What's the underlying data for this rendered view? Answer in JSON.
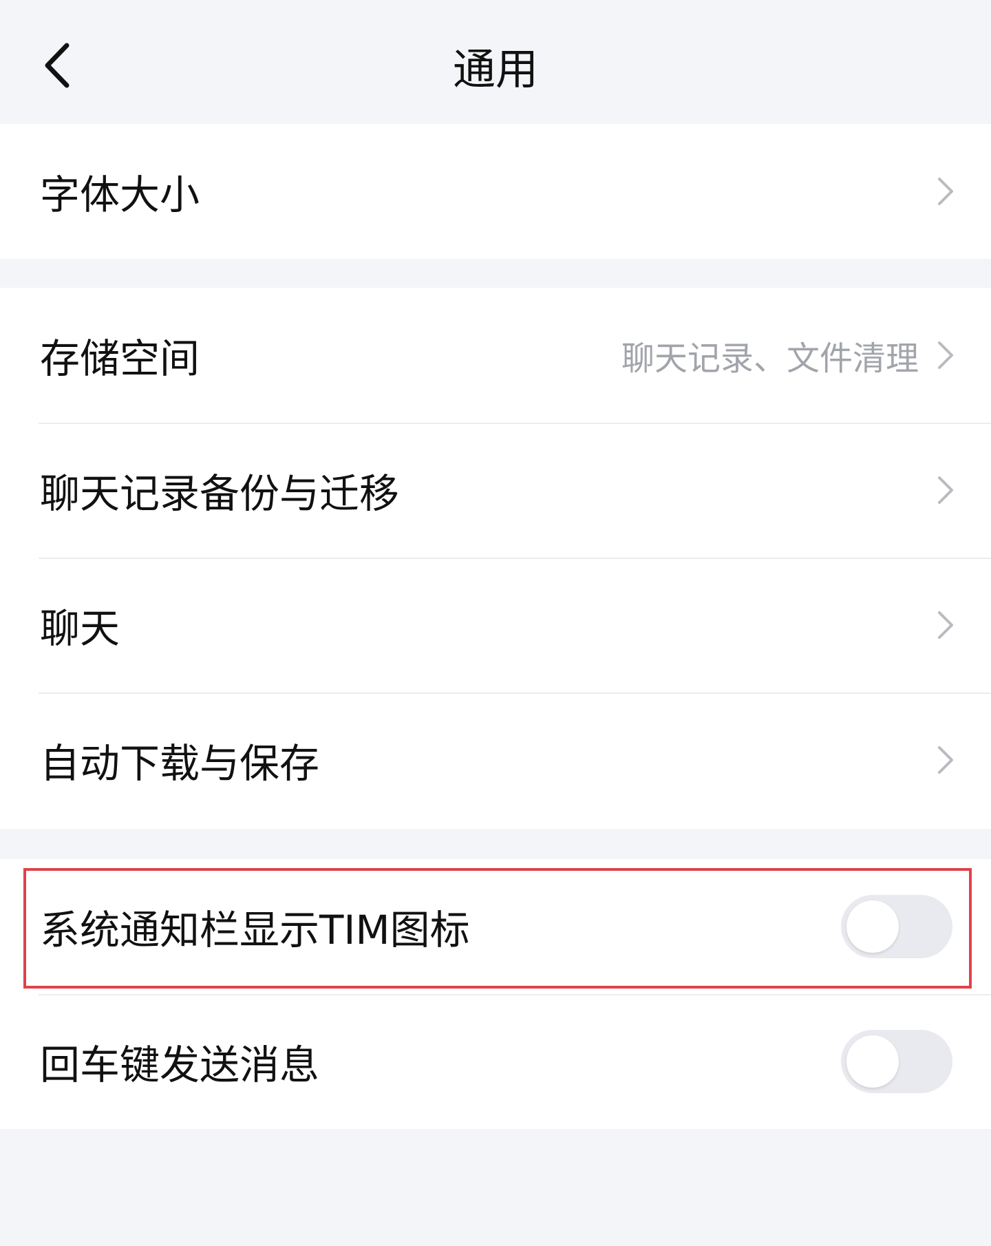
{
  "header": {
    "title": "通用",
    "back_icon": "chevron-left-icon"
  },
  "groups": [
    {
      "items": [
        {
          "label": "字体大小",
          "detail": "",
          "type": "link"
        }
      ]
    },
    {
      "items": [
        {
          "label": "存储空间",
          "detail": "聊天记录、文件清理",
          "type": "link"
        },
        {
          "label": "聊天记录备份与迁移",
          "detail": "",
          "type": "link"
        },
        {
          "label": "聊天",
          "detail": "",
          "type": "link"
        },
        {
          "label": "自动下载与保存",
          "detail": "",
          "type": "link"
        }
      ]
    },
    {
      "items": [
        {
          "label": "系统通知栏显示TIM图标",
          "type": "toggle",
          "enabled": false,
          "highlighted": true
        },
        {
          "label": "回车键发送消息",
          "type": "toggle",
          "enabled": false
        }
      ]
    }
  ],
  "colors": {
    "background": "#f4f5f9",
    "card": "#ffffff",
    "highlight": "#e0424a",
    "toggle_off": "#e9eaef"
  }
}
